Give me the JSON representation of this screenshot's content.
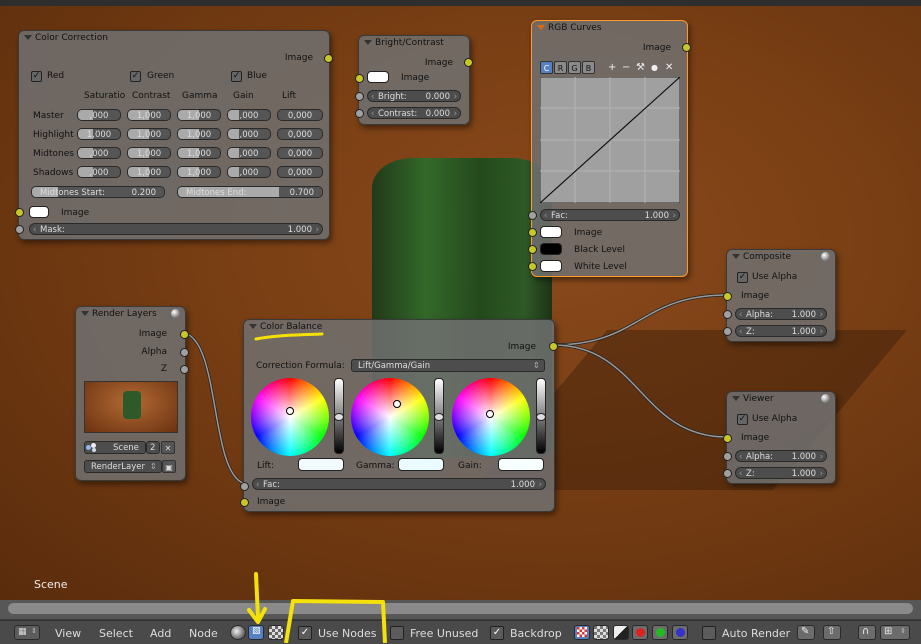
{
  "backdrop": {
    "scene_label": "Scene"
  },
  "color_correction": {
    "title": "Color Correction",
    "output_image": "Image",
    "channels": [
      "Red",
      "Green",
      "Blue"
    ],
    "columns": [
      "Saturatio",
      "Contrast",
      "Gamma",
      "Gain",
      "Lift"
    ],
    "rows": [
      {
        "label": "Master",
        "values": [
          ",000",
          "1,000",
          "1,000",
          ",000",
          "0,000"
        ]
      },
      {
        "label": "Highlight",
        "values": [
          "1,000",
          "1,000",
          "1,000",
          ",000",
          "0,000"
        ]
      },
      {
        "label": "Midtones",
        "values": [
          ",000",
          "1,000",
          "1,000",
          ",000",
          "0,000"
        ]
      },
      {
        "label": "Shadows",
        "values": [
          ",000",
          "1,000",
          "1,000",
          ",000",
          "0,000"
        ]
      }
    ],
    "midtones_start_label": "Midtones Start:",
    "midtones_start_value": "0.200",
    "midtones_end_label": "Midtones End:",
    "midtones_end_value": "0.700",
    "input_image": "Image",
    "mask_label": "Mask:",
    "mask_value": "1.000"
  },
  "bright_contrast": {
    "title": "Bright/Contrast",
    "output_image": "Image",
    "input_image": "Image",
    "bright_label": "Bright:",
    "bright_value": "0.000",
    "contrast_label": "Contrast:",
    "contrast_value": "0.000"
  },
  "rgb_curves": {
    "title": "RGB Curves",
    "output_image": "Image",
    "tabs": [
      "C",
      "R",
      "G",
      "B"
    ],
    "tools": [
      "+",
      "−",
      "⚒",
      "●",
      "✕"
    ],
    "fac_label": "Fac:",
    "fac_value": "1.000",
    "input_image": "Image",
    "black_level": "Black Level",
    "white_level": "White Level"
  },
  "composite": {
    "title": "Composite",
    "use_alpha": "Use Alpha",
    "input_image": "Image",
    "alpha_label": "Alpha:",
    "alpha_value": "1.000",
    "z_label": "Z:",
    "z_value": "1.000"
  },
  "viewer": {
    "title": "Viewer",
    "use_alpha": "Use Alpha",
    "input_image": "Image",
    "alpha_label": "Alpha:",
    "alpha_value": "1.000",
    "z_label": "Z:",
    "z_value": "1.000"
  },
  "render_layers": {
    "title": "Render Layers",
    "outputs": [
      "Image",
      "Alpha",
      "Z"
    ],
    "scene_value": "Scene",
    "scene_users": "2",
    "layer_value": "RenderLayer"
  },
  "color_balance": {
    "title": "Color Balance",
    "output_image": "Image",
    "correction_label": "Correction Formula:",
    "correction_value": "Lift/Gamma/Gain",
    "wheel_labels": [
      "Lift:",
      "Gamma:",
      "Gain:"
    ],
    "fac_label": "Fac:",
    "fac_value": "1.000",
    "input_image": "Image"
  },
  "header": {
    "menus": [
      "View",
      "Select",
      "Add",
      "Node"
    ],
    "use_nodes_label": "Use Nodes",
    "free_unused_label": "Free Unused",
    "backdrop_label": "Backdrop",
    "auto_render_label": "Auto Render"
  },
  "colors": {
    "node_bg": "#707070",
    "selected_border": "#ff9a28",
    "socket_yellow": "#c7c729",
    "annotation": "#f5e10a"
  }
}
